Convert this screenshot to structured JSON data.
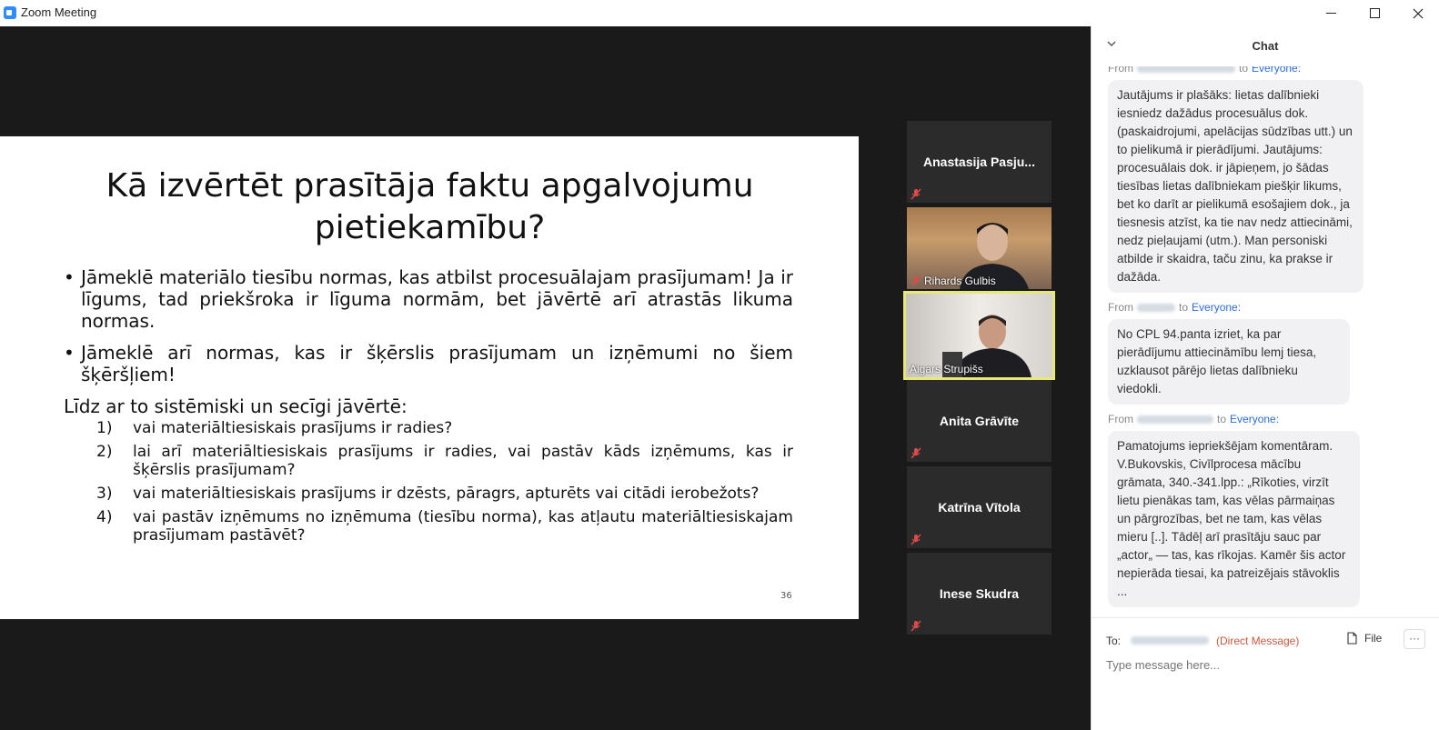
{
  "window": {
    "title": "Zoom Meeting",
    "icon": "zoom-app-icon"
  },
  "slide": {
    "title": "Kā izvērtēt prasītāja faktu apgalvojumu pietiekamību?",
    "bullets": [
      "Jāmeklē materiālo tiesību normas, kas atbilst procesuālajam prasījumam! Ja ir līgums, tad priekšroka ir līguma normām, bet jāvērtē arī atrastās likuma normas.",
      "Jāmeklē arī normas, kas ir šķērslis prasījumam un izņēmumi no šiem šķēršļiem!"
    ],
    "lead": "Līdz ar to sistēmiski un secīgi jāvērtē:",
    "items": [
      {
        "num": "1)",
        "text": "vai materiāltiesiskais prasījums ir radies?"
      },
      {
        "num": "2)",
        "text": "lai arī materiāltiesiskais prasījums ir radies, vai pastāv kāds izņēmums, kas ir šķērslis prasījumam?"
      },
      {
        "num": "3)",
        "text": "vai materiāltiesiskais prasījums ir dzēsts, pāragrs, apturēts vai citādi ierobežots?"
      },
      {
        "num": "4)",
        "text": "vai pastāv izņēmums no izņēmuma (tiesību norma), kas atļautu materiāltiesiskajam prasījumam pastāvēt?"
      }
    ],
    "page_number": "36"
  },
  "participants": [
    {
      "name": "Anastasija Pasju...",
      "video": false,
      "muted": true
    },
    {
      "name": "Rihards Gulbis",
      "video": true,
      "muted": true
    },
    {
      "name": "Aigars Strupišs",
      "video": true,
      "muted": false,
      "active_speaker": true
    },
    {
      "name": "Anita Grāvīte",
      "video": false,
      "muted": true
    },
    {
      "name": "Katrīna Vītola",
      "video": false,
      "muted": true
    },
    {
      "name": "Inese Skudra",
      "video": false,
      "muted": true
    }
  ],
  "chat": {
    "title": "Chat",
    "messages": [
      {
        "from": "From",
        "to": "to",
        "recipient": "Everyone:",
        "text": "Jautājums ir plašāks: lietas dalībnieki iesniedz dažādus procesuālus dok.(paskaidrojumi, apelācijas sūdzības utt.) un to pielikumā ir pierādījumi. Jautājums: procesuālais dok. ir jāpieņem, jo šādas tiesības lietas dalībniekam piešķir likums, bet ko darīt ar pielikumā esošajiem dok., ja tiesnesis atzīst, ka tie nav nedz attiecināmi, nedz pieļaujami (utm.). Man personiski atbilde ir skaidra, taču zinu, ka prakse ir dažāda."
      },
      {
        "from": "From",
        "to": "to",
        "recipient": "Everyone:",
        "text": "No CPL 94.panta izriet, ka par pierādījumu attiecināmību lemj tiesa, uzklausot pārējo lietas dalībnieku viedokli."
      },
      {
        "from": "From",
        "to": "to",
        "recipient": "Everyone:",
        "text": "Pamatojums iepriekšējam komentāram. V.Bukovskis, Civīlprocesa mācību grāmata, 340.-341.lpp.: „Rīkoties, virzīt lietu pienākas tam, kas vēlas pārmaiņas un pārgrozības, bet ne tam, kas vēlas mieru [..]. Tādēļ arī prasītāju sauc par „actor„ — tas, kas rīkojas. Kamēr šis actor nepierāda tiesai, ka patreizējais stāvoklis ..."
      }
    ],
    "footer": {
      "to_label": "To:",
      "dm_label": "(Direct Message)",
      "file_label": "File",
      "more_label": "···",
      "placeholder": "Type message here..."
    }
  },
  "colors": {
    "active_speaker_border": "#e6e879",
    "link_blue": "#2d6dd3",
    "dm_red": "#c85a3f"
  }
}
